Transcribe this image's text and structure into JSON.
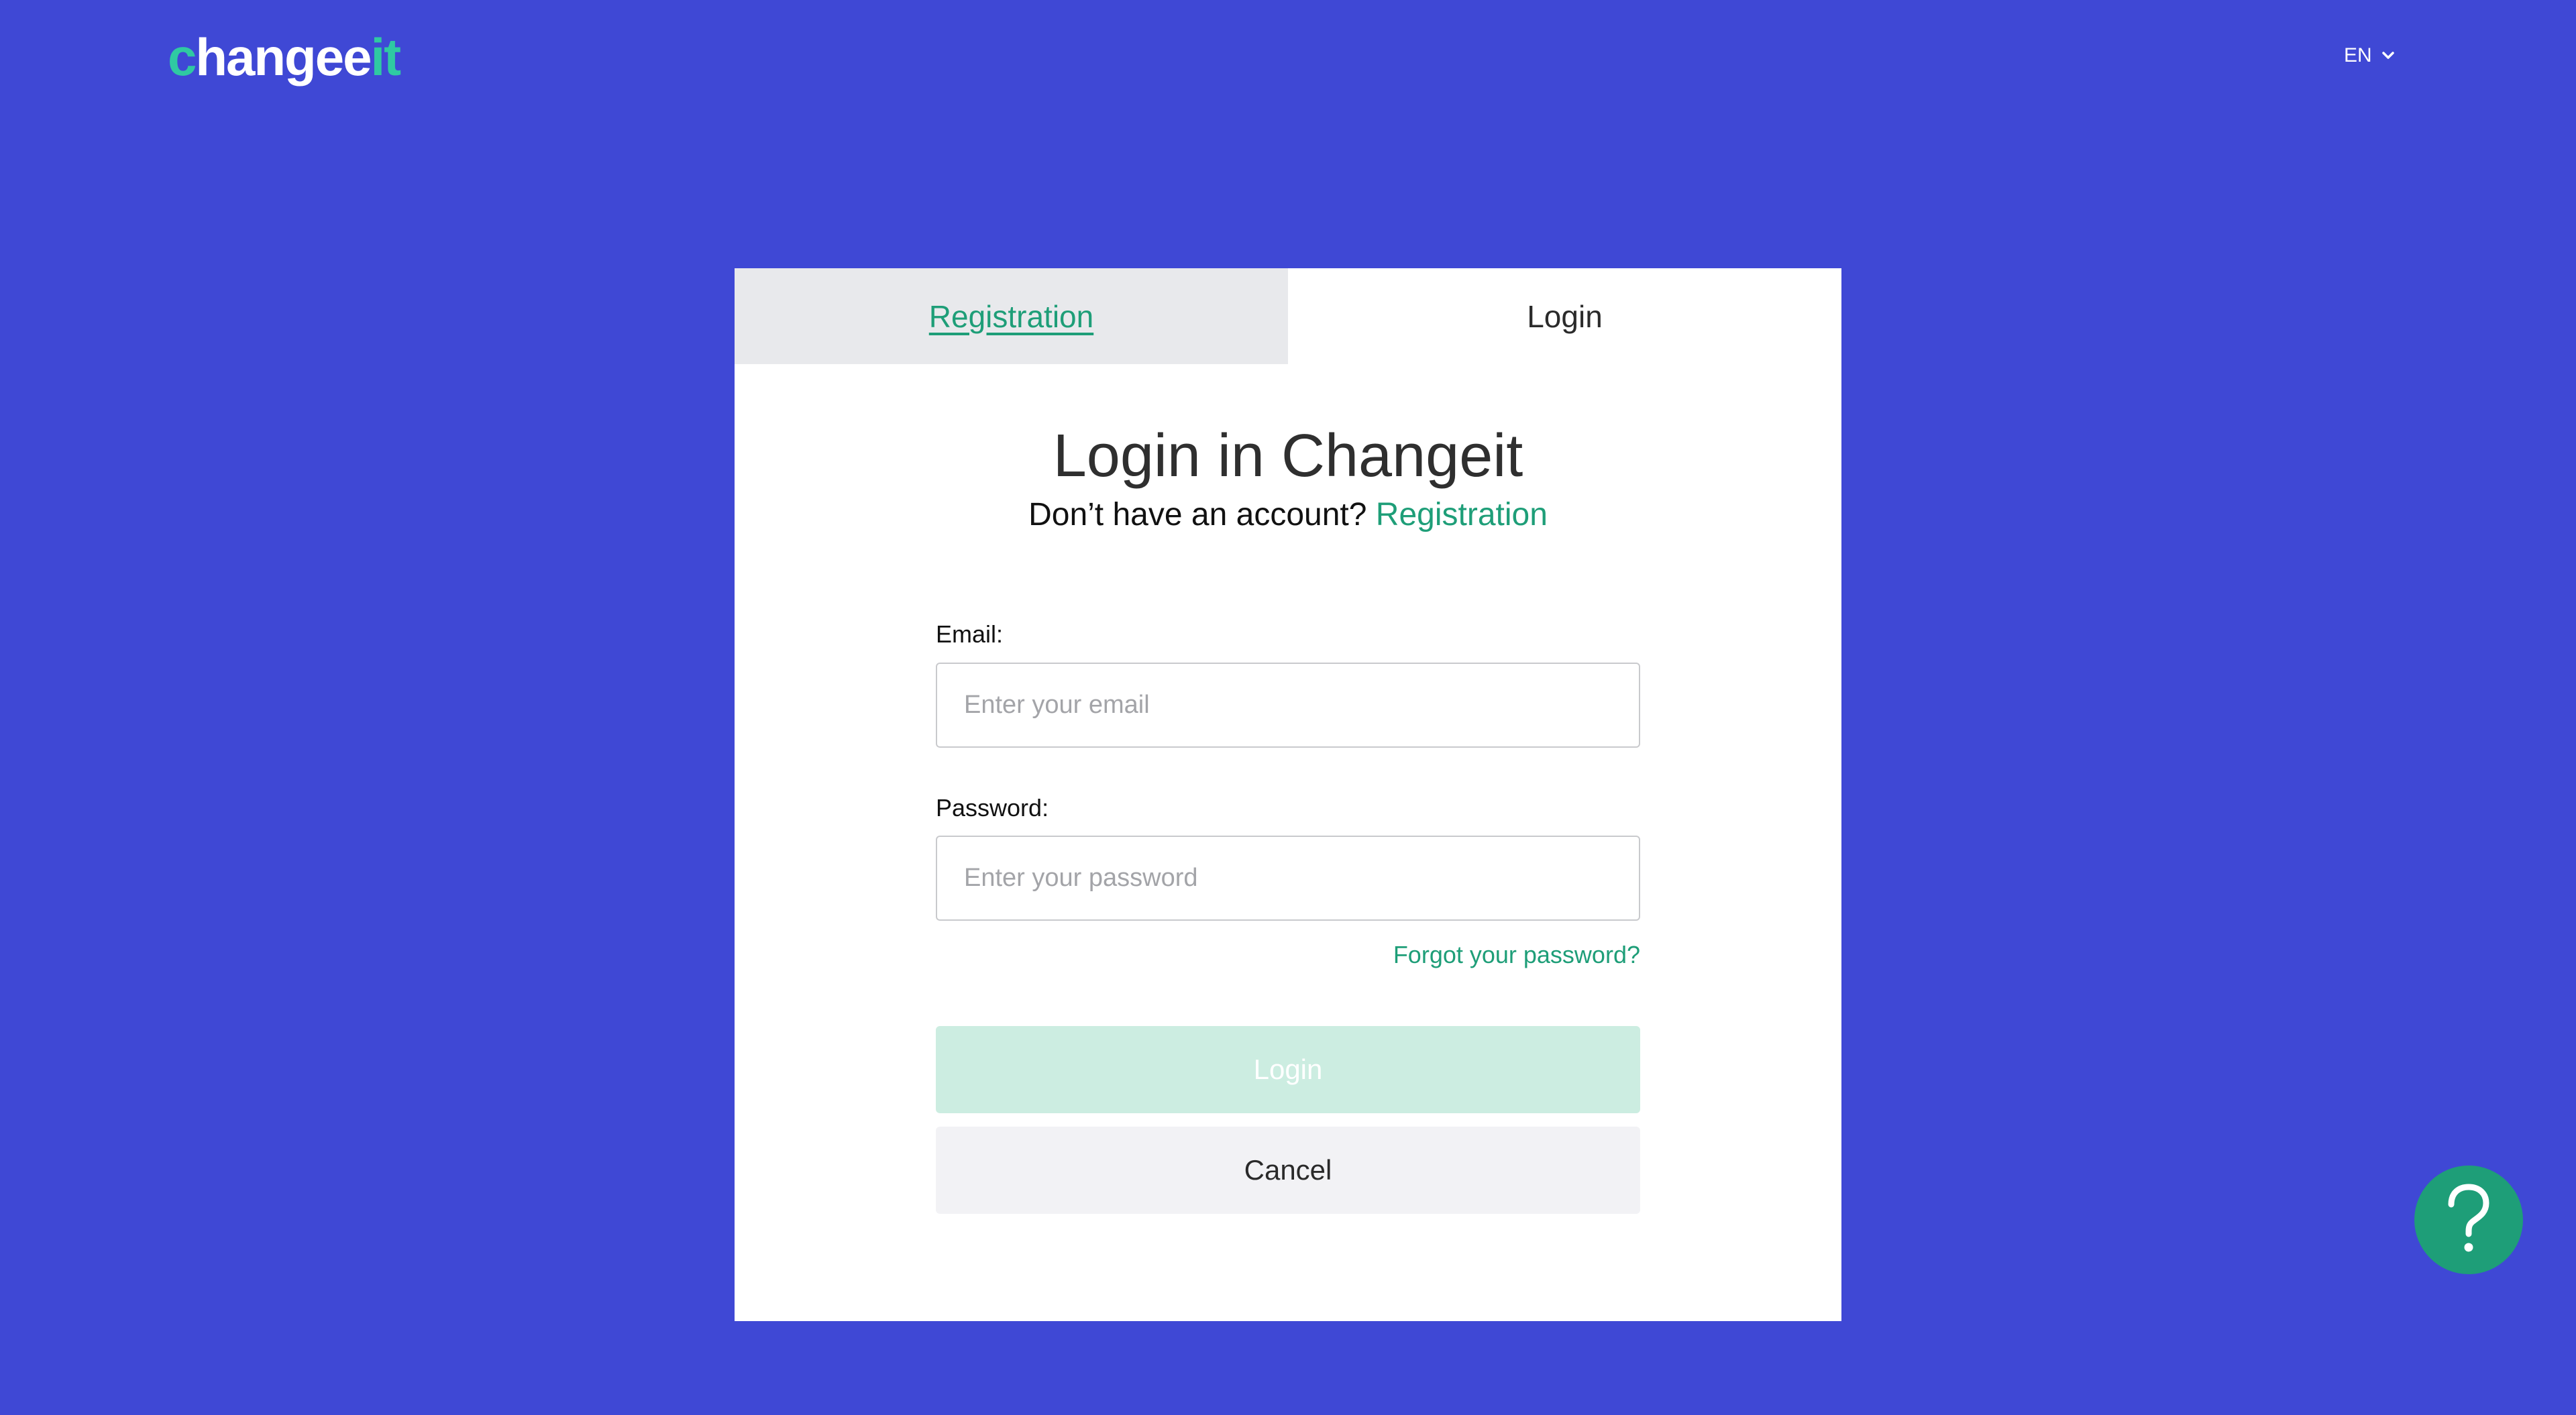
{
  "header": {
    "logo_text": {
      "part1": "c",
      "part2": "hange",
      "part3": "it"
    },
    "language": "EN"
  },
  "tabs": {
    "registration": "Registration",
    "login": "Login"
  },
  "login_form": {
    "title": "Login in Changeit",
    "subtitle_text": "Don’t have an account?",
    "subtitle_link": "Registration",
    "email_label": "Email:",
    "email_placeholder": "Enter your email",
    "email_value": "",
    "password_label": "Password:",
    "password_placeholder": "Enter your password",
    "password_value": "",
    "forgot_link": "Forgot your password?",
    "login_button": "Login",
    "cancel_button": "Cancel"
  },
  "help": {
    "icon": "question-mark-icon"
  },
  "colors": {
    "background": "#3f48d5",
    "accent_green": "#1e9e78",
    "logo_accent": "#2fc9a2",
    "login_button_disabled": "#ccede1",
    "cancel_button": "#f2f2f5",
    "inactive_tab": "#e8e9ec"
  }
}
